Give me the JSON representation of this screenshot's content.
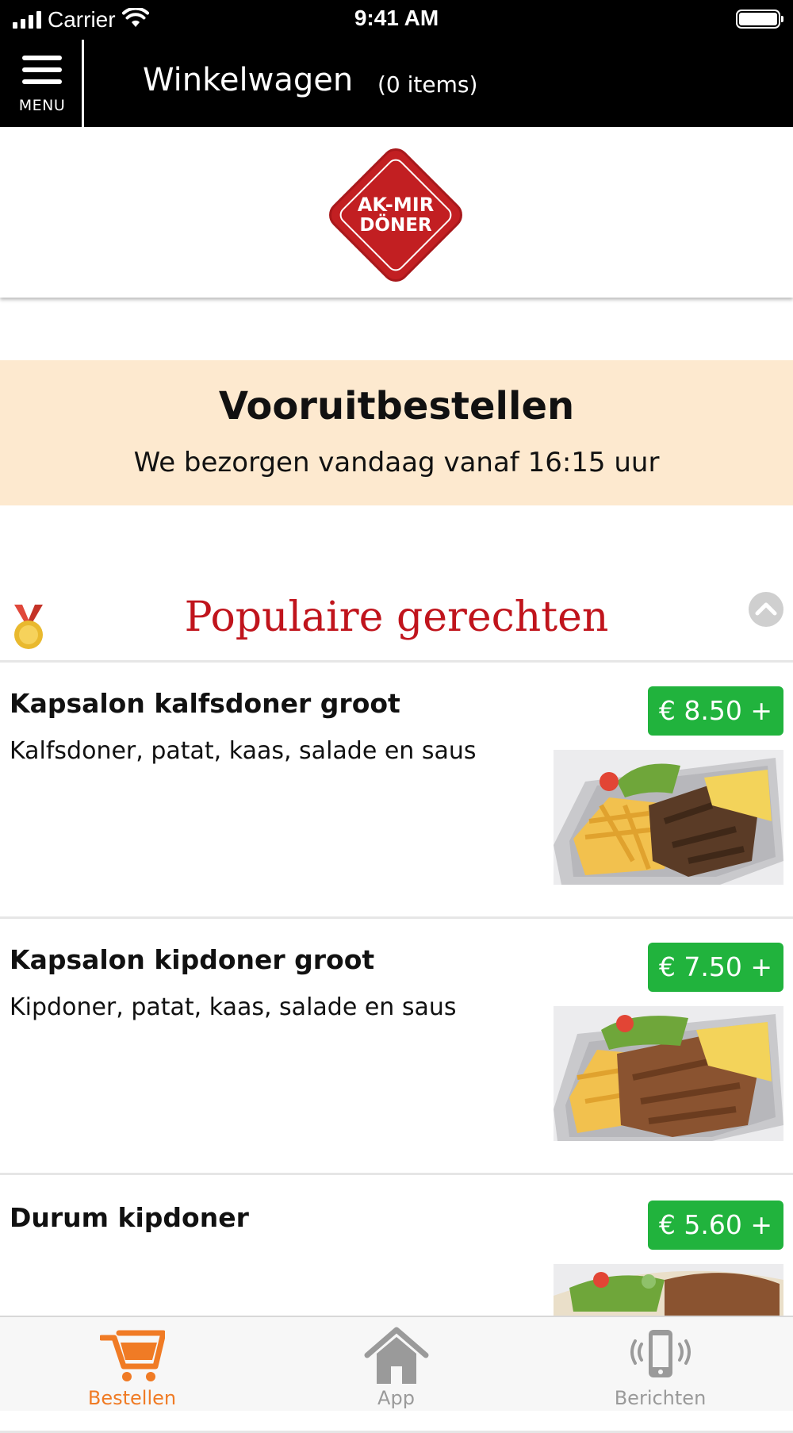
{
  "status_bar": {
    "carrier": "Carrier",
    "time": "9:41 AM"
  },
  "header": {
    "menu_label": "MENU",
    "cart_title": "Winkelwagen",
    "cart_count": "(0 items)"
  },
  "logo": {
    "line1": "AK-MIR",
    "line2": "DÖNER"
  },
  "banner": {
    "title": "Vooruitbestellen",
    "subtitle": "We bezorgen vandaag vanaf 16:15 uur"
  },
  "section": {
    "title": "Populaire gerechten"
  },
  "items": [
    {
      "name": "Kapsalon kalfsdoner groot",
      "description": "Kalfsdoner, patat, kaas, salade en saus",
      "price": "€ 8.50 +"
    },
    {
      "name": "Kapsalon kipdoner groot",
      "description": "Kipdoner, patat, kaas, salade en saus",
      "price": "€ 7.50 +"
    },
    {
      "name": "Durum kipdoner",
      "description": "",
      "price": "€ 5.60 +"
    }
  ],
  "tabbar": {
    "tabs": [
      {
        "label": "Bestellen",
        "icon": "cart-icon",
        "active": true
      },
      {
        "label": "App",
        "icon": "home-icon",
        "active": false
      },
      {
        "label": "Berichten",
        "icon": "phone-vibrate-icon",
        "active": false
      }
    ]
  },
  "colors": {
    "accent": "#f07b25",
    "price_badge": "#21b33d",
    "section_title": "#c0141c",
    "banner_bg": "#fde9cf",
    "header_bg": "#000000"
  }
}
